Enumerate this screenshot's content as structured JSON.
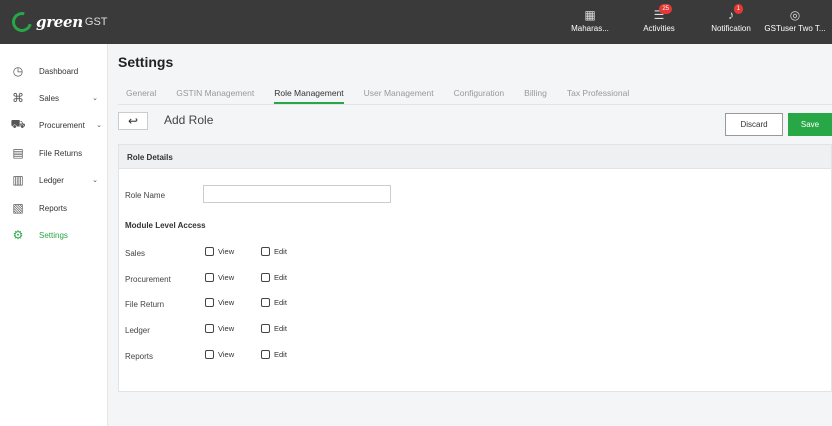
{
  "app": {
    "logo_text": "green",
    "logo_suffix": "GST"
  },
  "topbar": {
    "items": [
      {
        "icon": "▦",
        "label": "Maharas..."
      },
      {
        "icon": "☰",
        "label": "Activities",
        "badge": "25"
      },
      {
        "icon": "♪",
        "label": "Notification",
        "badge": "1"
      },
      {
        "icon": "◎",
        "label": "GSTuser Two T..."
      }
    ]
  },
  "sidebar": {
    "items": [
      {
        "label": "Dashboard",
        "icon": "◷"
      },
      {
        "label": "Sales",
        "icon": "⌘",
        "chevron": "⌄"
      },
      {
        "label": "Procurement",
        "icon": "⛟",
        "chevron": "⌄"
      },
      {
        "label": "File Returns",
        "icon": "▤"
      },
      {
        "label": "Ledger",
        "icon": "▥",
        "chevron": "⌄"
      },
      {
        "label": "Reports",
        "icon": "▧"
      },
      {
        "label": "Settings",
        "icon": "⚙"
      }
    ]
  },
  "page": {
    "title": "Settings"
  },
  "tabs": [
    "General",
    "GSTIN Management",
    "Role Management",
    "User Management",
    "Configuration",
    "Billing",
    "Tax Professional"
  ],
  "toolbar": {
    "back": "↩",
    "title": "Add Role",
    "discard": "Discard",
    "save": "Save"
  },
  "form": {
    "section_title": "Role Details",
    "role_name_label": "Role Name",
    "role_name_value": "",
    "module_access_title": "Module Level Access",
    "view_label": "View",
    "edit_label": "Edit",
    "modules": [
      "Sales",
      "Procurement",
      "File Return",
      "Ledger",
      "Reports"
    ]
  },
  "colors": {
    "accent": "#27a745",
    "topbar": "#3a3a3a",
    "badge": "#e53935"
  }
}
